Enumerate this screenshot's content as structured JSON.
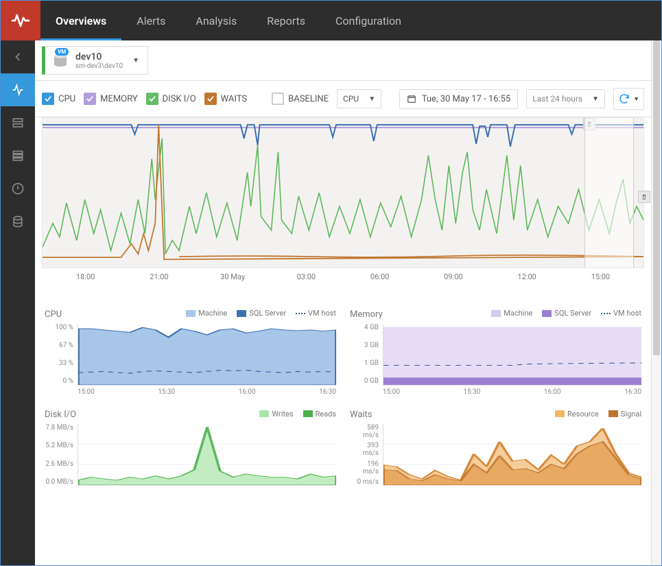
{
  "nav": {
    "tabs": [
      "Overviews",
      "Alerts",
      "Analysis",
      "Reports",
      "Configuration"
    ],
    "active": 0
  },
  "sidebar": {
    "items": [
      "back-icon",
      "activity-icon",
      "server1-icon",
      "server2-icon",
      "alert-circle-icon",
      "database-icon"
    ],
    "active": 1
  },
  "server": {
    "badge": "VM",
    "name": "dev10",
    "path": "sm-dev3\\dev10"
  },
  "toolbar": {
    "checks": [
      {
        "label": "CPU",
        "color": "#3498db",
        "checked": true
      },
      {
        "label": "MEMORY",
        "color": "#b39ddb",
        "checked": true
      },
      {
        "label": "DISK I/O",
        "color": "#66bb6a",
        "checked": true
      },
      {
        "label": "WAITS",
        "color": "#c07830",
        "checked": true
      }
    ],
    "baseline_label": "BASELINE",
    "baseline_checked": false,
    "baseline_select": "CPU",
    "datetime": "Tue, 30 May 17 - 16:55",
    "range": "Last 24 hours"
  },
  "chart_data": {
    "overview": {
      "type": "line",
      "x_ticks": [
        "18:00",
        "21:00",
        "30 May",
        "03:00",
        "06:00",
        "09:00",
        "12:00",
        "15:00"
      ],
      "series_names": [
        "CPU",
        "MEMORY",
        "DISK I/O",
        "WAITS"
      ],
      "ylim_pct": [
        0,
        100
      ]
    },
    "cpu": {
      "type": "area",
      "title": "CPU",
      "legend": [
        {
          "name": "Machine",
          "color": "#a8c6e8"
        },
        {
          "name": "SQL Server",
          "color": "#3b6fb0"
        },
        {
          "name": "VM host",
          "color": "#3b5998",
          "style": "dotted"
        }
      ],
      "y_ticks": [
        "100 %",
        "67 %",
        "33 %",
        "0 %"
      ],
      "x_ticks": [
        "15:00",
        "15:30",
        "16:00",
        "16:30"
      ],
      "series": [
        {
          "name": "Machine",
          "values": [
            92,
            92,
            90,
            88,
            86,
            94,
            90,
            78,
            92,
            88,
            82,
            90,
            92,
            85,
            88,
            92,
            90,
            89,
            90,
            88,
            90
          ]
        },
        {
          "name": "VM host",
          "values": [
            20,
            21,
            22,
            20,
            19,
            22,
            23,
            22,
            21,
            20,
            22,
            24,
            23,
            24,
            22,
            21,
            20,
            22,
            21,
            22,
            21
          ]
        }
      ]
    },
    "memory": {
      "type": "area",
      "title": "Memory",
      "legend": [
        {
          "name": "Machine",
          "color": "#d6c9ef"
        },
        {
          "name": "SQL Server",
          "color": "#9b7fd1"
        },
        {
          "name": "VM host",
          "color": "#3b5998",
          "style": "dotted"
        }
      ],
      "y_ticks": [
        "4 GB",
        "3 GB",
        "1 GB",
        "0 GB"
      ],
      "x_ticks": [
        "15:00",
        "15:30",
        "16:00",
        "16:30"
      ],
      "series": [
        {
          "name": "Machine",
          "values": [
            3.8,
            3.8,
            3.8,
            3.8,
            3.8,
            3.8,
            3.8,
            3.8,
            3.8,
            3.8,
            3.8,
            3.8,
            3.8,
            3.8,
            3.8,
            3.8,
            3.8,
            3.8,
            3.8,
            3.8,
            3.8
          ]
        },
        {
          "name": "SQL Server",
          "values": [
            0.5,
            0.5,
            0.5,
            0.5,
            0.5,
            0.5,
            0.5,
            0.5,
            0.5,
            0.5,
            0.5,
            0.5,
            0.5,
            0.5,
            0.5,
            0.5,
            0.5,
            0.5,
            0.5,
            0.5,
            0.5
          ]
        },
        {
          "name": "VM host",
          "values": [
            1.3,
            1.3,
            1.3,
            1.3,
            1.3,
            1.3,
            1.3,
            1.3,
            1.3,
            1.3,
            1.3,
            1.35,
            1.35,
            1.35,
            1.4,
            1.4,
            1.4,
            1.4,
            1.4,
            1.4,
            1.4
          ]
        }
      ]
    },
    "diskio": {
      "type": "area",
      "title": "Disk I/O",
      "legend": [
        {
          "name": "Writes",
          "color": "#a8e6a8"
        },
        {
          "name": "Reads",
          "color": "#4caf50"
        }
      ],
      "y_ticks": [
        "7.8 MB/s",
        "5.2 MB/s",
        "2.6 MB/s",
        "0.0 MB/s"
      ],
      "x_ticks": [
        "15:00",
        "15:30",
        "16:00",
        "16:30"
      ],
      "series": [
        {
          "name": "Writes",
          "values": [
            0.6,
            1.0,
            0.8,
            0.6,
            1.0,
            0.8,
            1.2,
            0.8,
            1.2,
            2.0,
            7.4,
            1.8,
            1.0,
            1.4,
            1.2,
            1.0,
            1.0,
            0.8,
            1.4,
            1.0,
            1.2
          ]
        }
      ]
    },
    "waits": {
      "type": "area",
      "title": "Waits",
      "legend": [
        {
          "name": "Resource",
          "color": "#f3b668"
        },
        {
          "name": "Signal",
          "color": "#c0752e"
        }
      ],
      "y_ticks": [
        "589 ms/s",
        "393 ms/s",
        "196 ms/s",
        "0 ms/s"
      ],
      "x_ticks": [
        "15:00",
        "15:30",
        "16:00",
        "16:30"
      ],
      "series": [
        {
          "name": "Resource",
          "values": [
            196,
            180,
            100,
            60,
            140,
            80,
            50,
            300,
            180,
            420,
            230,
            250,
            150,
            290,
            200,
            380,
            420,
            550,
            300,
            120,
            80
          ]
        },
        {
          "name": "Signal",
          "values": [
            150,
            140,
            60,
            40,
            100,
            60,
            40,
            200,
            120,
            280,
            150,
            160,
            120,
            200,
            160,
            300,
            380,
            420,
            260,
            100,
            60
          ]
        }
      ]
    }
  }
}
